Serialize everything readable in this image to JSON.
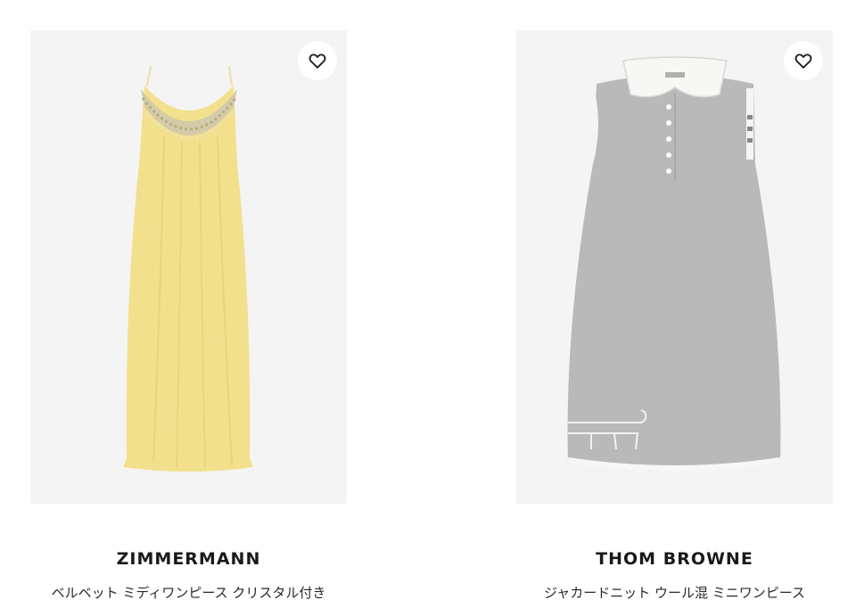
{
  "products": [
    {
      "brand": "ZIMMERMANN",
      "name": "ベルベット ミディワンピース クリスタル付き",
      "image_description_icon": "yellow-dress-image",
      "wishlist_icon": "heart-icon",
      "colors": {
        "dress": "#f2e08d",
        "dress_shadow": "#e6d177",
        "crystal": "#cfc6a8"
      }
    },
    {
      "brand": "THOM BROWNE",
      "name": "ジャカードニット ウール混 ミニワンピース",
      "image_description_icon": "gray-dress-image",
      "wishlist_icon": "heart-icon",
      "colors": {
        "dress": "#b9b9b9",
        "dress_shadow": "#a9a9a9",
        "collar": "#f7f7f5"
      }
    }
  ],
  "colors": {
    "background": "#ffffff",
    "image_background": "#f4f4f4",
    "text": "#1a1a1a"
  }
}
